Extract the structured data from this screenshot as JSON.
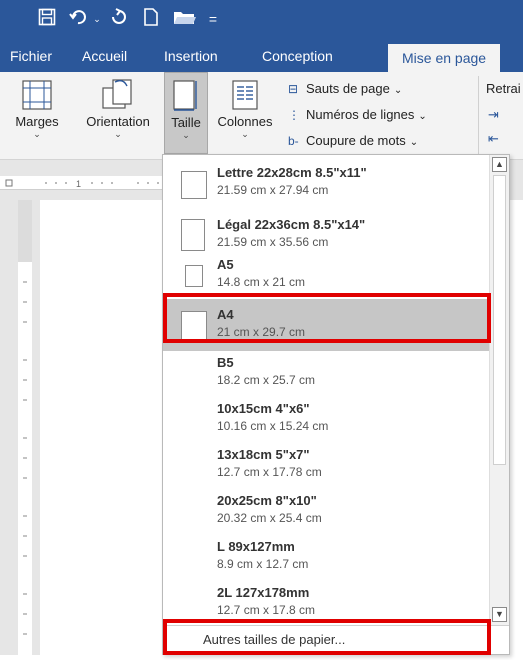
{
  "quick_access": {
    "icons": [
      "save-icon",
      "undo-icon",
      "redo-icon",
      "new-document-icon",
      "open-folder-icon",
      "customize-icon"
    ]
  },
  "tabs": [
    {
      "label": "Fichier"
    },
    {
      "label": "Accueil"
    },
    {
      "label": "Insertion"
    },
    {
      "label": "Conception"
    },
    {
      "label": "Mise en page",
      "active": true
    }
  ],
  "ribbon": {
    "margins_label": "Marges",
    "orientation_label": "Orientation",
    "size_label": "Taille",
    "columns_label": "Colonnes",
    "page_breaks_label": "Sauts de page",
    "line_numbers_label": "Numéros de lignes",
    "hyphenation_label": "Coupure de mots",
    "indent_label": "Retrai"
  },
  "size_menu": {
    "items": [
      {
        "name": "Lettre 22x28cm 8.5\"x11\"",
        "dims": "21.59 cm x 27.94 cm"
      },
      {
        "name": "Légal 22x36cm 8.5\"x14\"",
        "dims": "21.59 cm x 35.56 cm"
      },
      {
        "name": "A5",
        "dims": "14.8 cm x 21 cm"
      },
      {
        "name": "A4",
        "dims": "21 cm x 29.7 cm",
        "selected": true
      },
      {
        "name": "B5",
        "dims": "18.2 cm x 25.7 cm"
      },
      {
        "name": "10x15cm 4\"x6\"",
        "dims": "10.16 cm x 15.24 cm"
      },
      {
        "name": "13x18cm 5\"x7\"",
        "dims": "12.7 cm x 17.78 cm"
      },
      {
        "name": "20x25cm 8\"x10\"",
        "dims": "20.32 cm x 25.4 cm"
      },
      {
        "name": "L 89x127mm",
        "dims": "8.9 cm x 12.7 cm"
      },
      {
        "name": "2L 127x178mm",
        "dims": "12.7 cm x 17.8 cm"
      }
    ],
    "more_sizes": "Autres tailles de papier..."
  },
  "colors": {
    "ribbon_blue": "#2b579a",
    "highlight_red": "#e00000",
    "selected_gray": "#c6c6c6"
  }
}
